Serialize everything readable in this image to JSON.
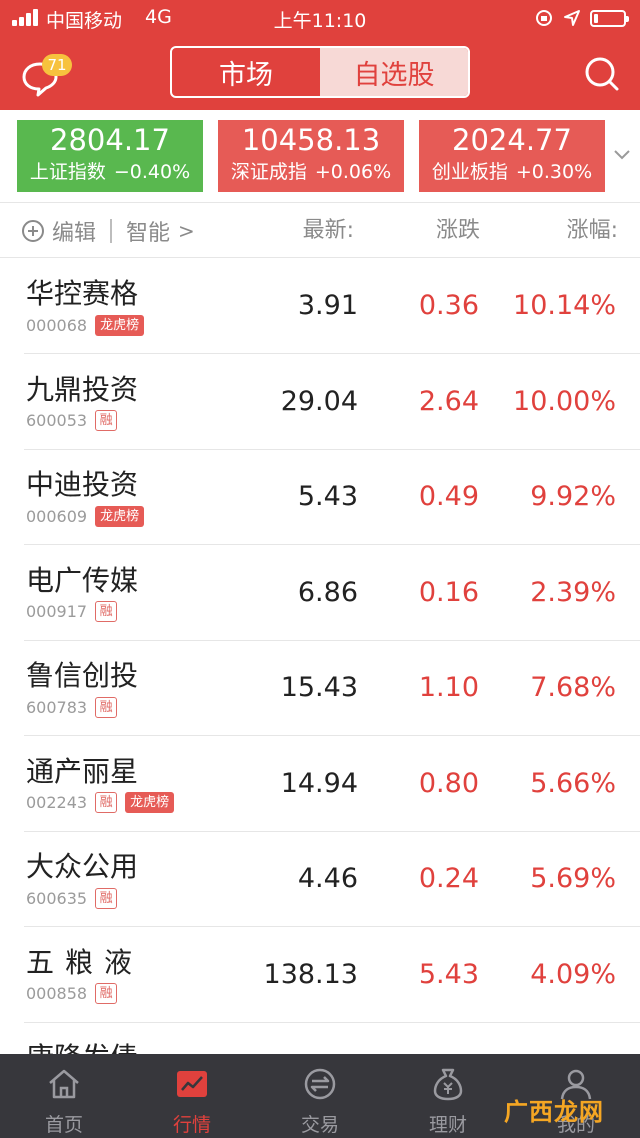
{
  "status_bar": {
    "carrier": "中国移动",
    "network": "4G",
    "time": "上午11:10",
    "signal_bars": 4,
    "battery_level": 0.15
  },
  "header": {
    "message_badge": "71",
    "tabs": [
      {
        "label": "市场",
        "active": false
      },
      {
        "label": "自选股",
        "active": true
      }
    ],
    "icons": [
      "message-icon",
      "search-icon"
    ]
  },
  "indices": [
    {
      "value": "2804.17",
      "name": "上证指数",
      "change": "−0.40%",
      "color": "#59b84f"
    },
    {
      "value": "10458.13",
      "name": "深证成指",
      "change": "+0.06%",
      "color": "#e65b56"
    },
    {
      "value": "2024.77",
      "name": "创业板指",
      "change": "+0.30%",
      "color": "#e65b56"
    }
  ],
  "column_header": {
    "edit": "编辑",
    "smart": "智能",
    "smart_chevron": ">",
    "last": "最新:",
    "change": "涨跌",
    "change_pct": "涨幅:"
  },
  "stocks": [
    {
      "name": "华控赛格",
      "code": "000068",
      "tags": [
        "龙虎榜"
      ],
      "last": "3.91",
      "change": "0.36",
      "change_pct": "10.14%"
    },
    {
      "name": "九鼎投资",
      "code": "600053",
      "tags": [
        "融"
      ],
      "last": "29.04",
      "change": "2.64",
      "change_pct": "10.00%"
    },
    {
      "name": "中迪投资",
      "code": "000609",
      "tags": [
        "龙虎榜"
      ],
      "last": "5.43",
      "change": "0.49",
      "change_pct": "9.92%"
    },
    {
      "name": "电广传媒",
      "code": "000917",
      "tags": [
        "融"
      ],
      "last": "6.86",
      "change": "0.16",
      "change_pct": "2.39%"
    },
    {
      "name": "鲁信创投",
      "code": "600783",
      "tags": [
        "融"
      ],
      "last": "15.43",
      "change": "1.10",
      "change_pct": "7.68%"
    },
    {
      "name": "通产丽星",
      "code": "002243",
      "tags": [
        "融",
        "龙虎榜"
      ],
      "last": "14.94",
      "change": "0.80",
      "change_pct": "5.66%"
    },
    {
      "name": "大众公用",
      "code": "600635",
      "tags": [
        "融"
      ],
      "last": "4.46",
      "change": "0.24",
      "change_pct": "5.69%"
    },
    {
      "name": "五粮液",
      "code": "000858",
      "tags": [
        "融"
      ],
      "last": "138.13",
      "change": "5.43",
      "change_pct": "4.09%"
    },
    {
      "name": "康隆发债",
      "code": "",
      "tags": [],
      "last": "",
      "change": "",
      "change_pct": ""
    }
  ],
  "tabbar": [
    {
      "label": "首页",
      "icon": "home-icon",
      "active": false
    },
    {
      "label": "行情",
      "icon": "market-chart-icon",
      "active": true
    },
    {
      "label": "交易",
      "icon": "trade-icon",
      "active": false
    },
    {
      "label": "理财",
      "icon": "wealth-icon",
      "active": false
    },
    {
      "label": "我的",
      "icon": "profile-icon",
      "active": false
    }
  ],
  "watermark": "广西龙网",
  "colors": {
    "brand_red": "#e0413d",
    "up_red": "#e0413d",
    "down_green": "#59b84f",
    "tabbar_bg": "#37373c"
  }
}
